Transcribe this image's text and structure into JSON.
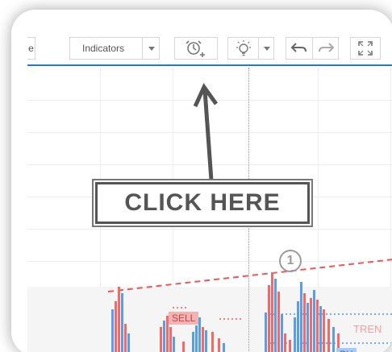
{
  "toolbar": {
    "partial_left_label": "e",
    "indicators_label": "Indicators"
  },
  "callout": {
    "text": "CLICK HERE"
  },
  "chart": {
    "marker_number": "1",
    "sell_label": "SELL",
    "buy_label": "BU",
    "trend_label": "TREN"
  },
  "colors": {
    "accent_blue": "#2a79c8",
    "bear_red": "#f06a6a",
    "bull_blue": "#5b9ee8"
  },
  "icons": [
    "chevron-down-icon",
    "alarm-add-icon",
    "lightbulb-icon",
    "undo-icon",
    "redo-icon",
    "fullscreen-icon",
    "arrow-up-icon"
  ]
}
